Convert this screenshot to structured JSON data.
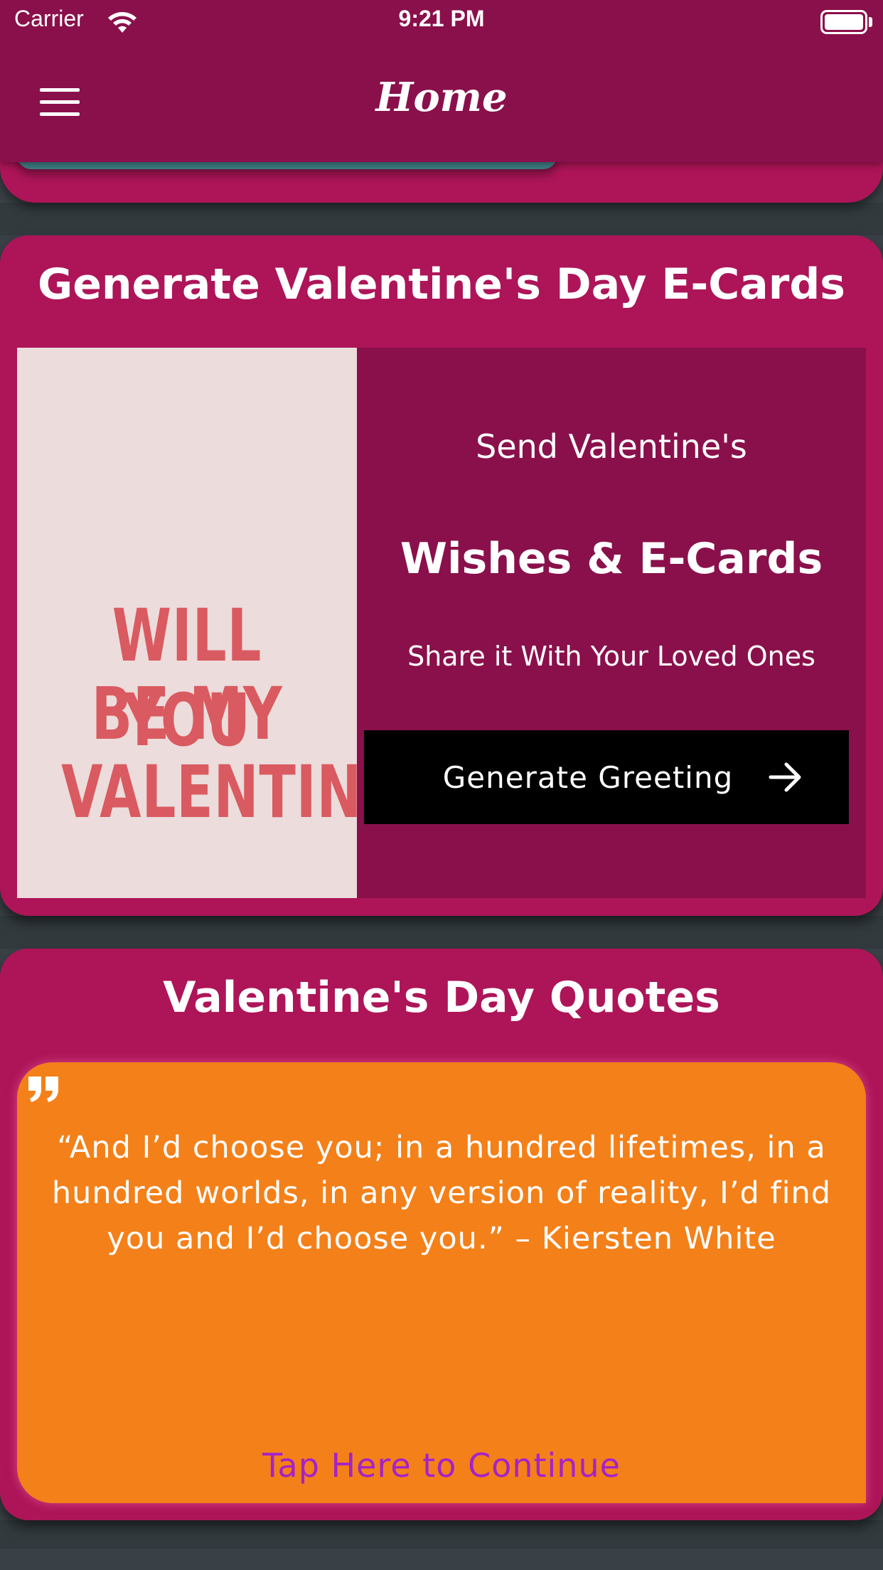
{
  "status_bar": {
    "carrier": "Carrier",
    "time": "9:21 PM"
  },
  "nav": {
    "title": "Home",
    "menu_icon": "hamburger-menu-icon"
  },
  "ecards_section": {
    "title": "Generate Valentine's Day E-Cards",
    "image_text": [
      "WILL YOU",
      "BE MY",
      "VALENTINE?"
    ],
    "line1": "Send Valentine's",
    "line2": "Wishes & E-Cards",
    "line3": "Share it With Your Loved Ones",
    "button_label": "Generate Greeting",
    "button_icon": "arrow-right-icon"
  },
  "quotes_section": {
    "title": "Valentine's Day Quotes",
    "quote_icon": "quote-mark-icon",
    "quote": "“And I’d choose you; in a hundred lifetimes, in a hundred worlds, in any version of reality, I’d find you and I’d choose you.” – Kiersten White",
    "link": "Tap Here to Continue"
  },
  "colors": {
    "nav_bg": "#8a104b",
    "card_bg": "#ad1558",
    "panel_bg": "#8a104b",
    "quote_bg": "#f48019",
    "link": "#a522c9",
    "image_bg": "#ecdcdc",
    "image_text": "#d95a60"
  }
}
